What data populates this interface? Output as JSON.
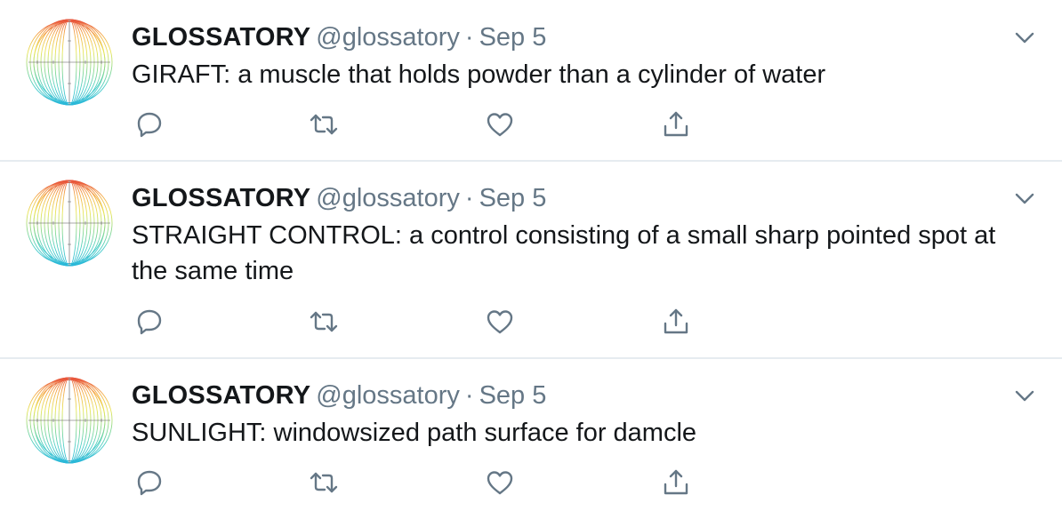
{
  "tweets": [
    {
      "display_name": "GLOSSATORY",
      "handle": "@glossatory",
      "separator": "·",
      "date": "Sep 5",
      "text": "GIRAFT: a muscle that holds powder than a cylinder of water"
    },
    {
      "display_name": "GLOSSATORY",
      "handle": "@glossatory",
      "separator": "·",
      "date": "Sep 5",
      "text": "STRAIGHT CONTROL: a control consisting of a small sharp pointed spot at the same time"
    },
    {
      "display_name": "GLOSSATORY",
      "handle": "@glossatory",
      "separator": "·",
      "date": "Sep 5",
      "text": "SUNLIGHT: windowsized path surface for damcle"
    }
  ],
  "icons": {
    "reply": "reply-icon",
    "retweet": "retweet-icon",
    "like": "heart-icon",
    "share": "share-icon",
    "menu": "chevron-down-icon"
  },
  "colors": {
    "text_primary": "#14171a",
    "text_secondary": "#657786",
    "divider": "#e6ecf0",
    "icon": "#657786"
  }
}
